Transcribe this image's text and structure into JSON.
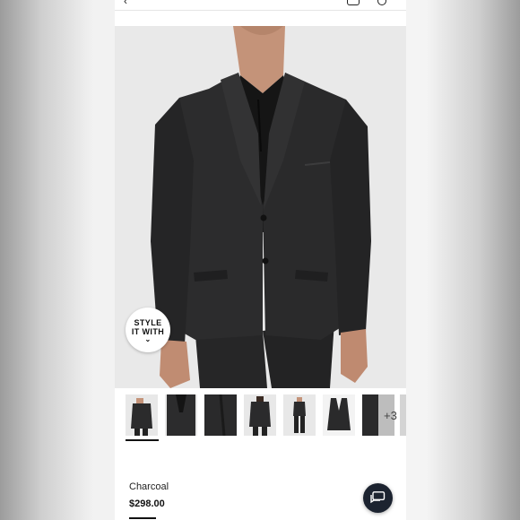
{
  "header": {
    "back_icon": "chevron-left-icon",
    "bag_icon": "shopping-bag-icon",
    "search_icon": "search-icon"
  },
  "hero": {
    "image": "model wearing charcoal suit jacket over black polo"
  },
  "style_badge": {
    "line1": "STYLE",
    "line2": "IT WITH",
    "icon": "chevron-down-icon"
  },
  "thumbnails": {
    "more_label": "+3",
    "selected_index": 0
  },
  "product": {
    "color_name": "Charcoal",
    "price": "$298.00"
  },
  "chat": {
    "icon": "chat-bubble-icon"
  },
  "colors": {
    "jacket": "#2b2b2c",
    "shirt": "#151515",
    "chat_button": "#1c2330"
  }
}
